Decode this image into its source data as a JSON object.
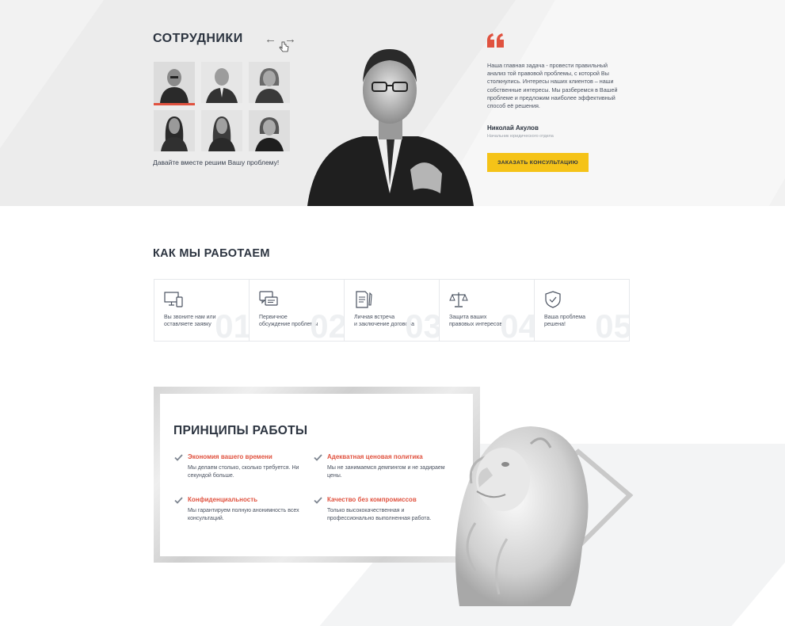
{
  "staff": {
    "title": "СОТРУДНИКИ",
    "prev_arrow": "←",
    "next_arrow": "→",
    "tagline": "Давайте вместе решим Вашу проблему!",
    "thumbnails": [
      "Николай Акулов",
      "Сотрудник 2",
      "Сотрудник 3",
      "Сотрудник 4",
      "Сотрудник 5",
      "Сотрудник 6"
    ]
  },
  "quote": {
    "text": "Наша главная задача - провести правильный анализ той правовой проблемы, с которой Вы столкнулись. Интересы наших клиентов – наши собственные интересы. Мы разберемся в Вашей проблеме и предложим наиболее эффективный способ её решения.",
    "author": "Николай Акулов",
    "role": "Начальник юридического отдела",
    "cta": "ЗАКАЗАТЬ КОНСУЛЬТАЦИЮ"
  },
  "how": {
    "title": "КАК МЫ РАБОТАЕМ",
    "steps": [
      {
        "icon": "monitor-phone-icon",
        "line1": "Вы звоните нам или",
        "line2": "оставляете заявку",
        "num": "01"
      },
      {
        "icon": "chat-bubbles-icon",
        "line1": "Первичное",
        "line2": "обсуждение проблемы",
        "num": "02"
      },
      {
        "icon": "document-pen-icon",
        "line1": "Личная встреча",
        "line2": "и заключение договора",
        "num": "03"
      },
      {
        "icon": "scales-icon",
        "line1": "Защита ваших",
        "line2": "правовых интересов",
        "num": "04"
      },
      {
        "icon": "shield-check-icon",
        "line1": "Ваша проблема",
        "line2": "решена!",
        "num": "05"
      }
    ]
  },
  "principles": {
    "title": "ПРИНЦИПЫ РАБОТЫ",
    "items": [
      {
        "head": "Экономия вашего времени",
        "text": "Мы делаем столько, сколько требуется. Ни секундой больше."
      },
      {
        "head": "Адекватная ценовая политика",
        "text": "Мы не занимаемся демпингом и не задираем цены."
      },
      {
        "head": "Конфиденциальность",
        "text": "Мы гарантируем полную анонимность всех консультаций."
      },
      {
        "head": "Качество без компромиссов",
        "text": "Только высококачественная и профессионально выполненная работа."
      }
    ]
  },
  "colors": {
    "accent": "#e0523f",
    "cta": "#f5c318",
    "text": "#2c3440"
  }
}
